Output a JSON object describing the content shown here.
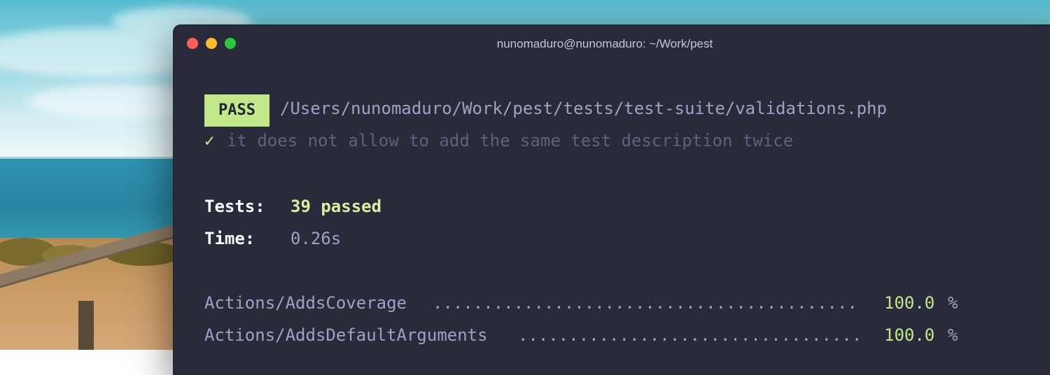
{
  "window": {
    "title": "nunomaduro@nunomaduro: ~/Work/pest"
  },
  "terminal": {
    "badge": "PASS",
    "file_path": "/Users/nunomaduro/Work/pest/tests/test-suite/validations.php",
    "check_mark": "✓",
    "test_description": "it does not allow to add the same test description twice",
    "tests_label": "Tests:",
    "tests_value": "39 passed",
    "time_label": "Time:",
    "time_value": "0.26s",
    "coverage": [
      {
        "name": "Actions/AddsCoverage",
        "dots": "..........................................",
        "value": "100.0",
        "unit": "%"
      },
      {
        "name": "Actions/AddsDefaultArguments",
        "dots": "..................................",
        "value": "100.0",
        "unit": "%"
      }
    ]
  },
  "colors": {
    "terminal_bg": "#292b3b",
    "pass_badge": "#c2e88a",
    "passed_text": "#d7f0a0",
    "muted_text": "#9da3c4"
  }
}
